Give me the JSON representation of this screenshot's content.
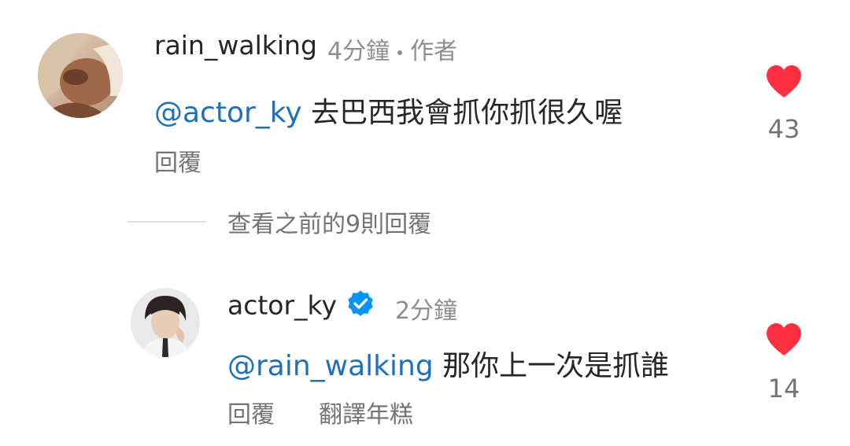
{
  "comments": [
    {
      "username": "rain_walking",
      "time": "4分鐘",
      "tag": "作者",
      "mention": "@actor_ky",
      "text": "去巴西我會抓你抓很久喔",
      "reply_label": "回覆",
      "like_count": "43"
    },
    {
      "username": "actor_ky",
      "time": "2分鐘",
      "mention": "@rain_walking",
      "text": "那你上一次是抓誰",
      "reply_label": "回覆",
      "translate_label": "翻譯年糕",
      "like_count": "14"
    }
  ],
  "view_previous": "查看之前的9則回覆",
  "colors": {
    "mention": "#1f6fb9",
    "heart": "#ff3040",
    "verified": "#0095f6",
    "meta": "#8e8e8e"
  },
  "icons": {
    "like": "heart-icon",
    "verified": "verified-badge-icon"
  }
}
